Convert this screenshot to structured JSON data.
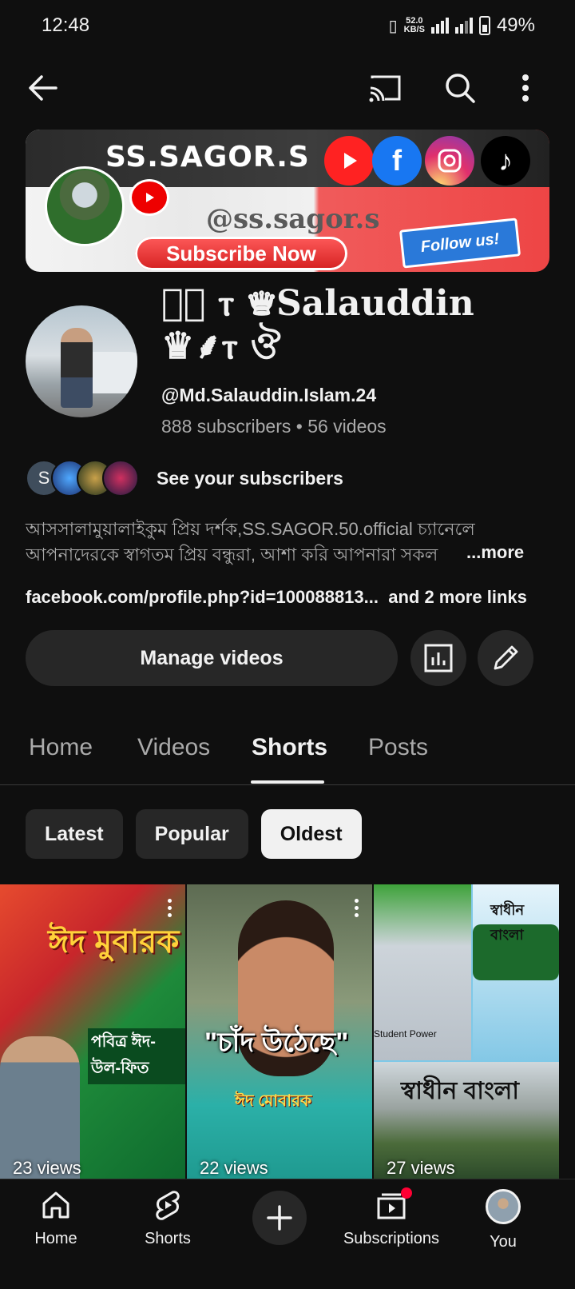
{
  "status": {
    "time": "12:48",
    "net_speed_value": "52.0",
    "net_speed_unit": "KB/S",
    "battery": "49%"
  },
  "banner": {
    "title": "SS.SAGOR.S",
    "handle": "@ss.sagor.s",
    "subscribe": "Subscribe Now",
    "follow": "Follow us!"
  },
  "channel": {
    "name_deco_left": "ঔ৾ ⲧ ♛",
    "name_text": "Salauddin",
    "name_deco_right": "♛⸙ⲧ ঔ",
    "handle": "@Md.Salauddin.Islam.24",
    "stats": "888 subscribers • 56 videos"
  },
  "subscribers_row": {
    "initial": "S",
    "label": "See your subscribers"
  },
  "description": {
    "line1": "আসসালামুয়ালাইকুম প্রিয় দর্শক,SS.SAGOR.50.official  চ্যানেলে",
    "line2": "আপনাদেরকে স্বাগতম প্রিয় বন্ধুরা, আশা করি আপনারা সকল",
    "more": "...more"
  },
  "links": {
    "primary": "facebook.com/profile.php?id=100088813...",
    "extra": "and 2 more links"
  },
  "actions": {
    "manage": "Manage videos"
  },
  "tabs": [
    {
      "label": "Home"
    },
    {
      "label": "Videos"
    },
    {
      "label": "Shorts"
    },
    {
      "label": "Posts"
    }
  ],
  "active_tab": "Shorts",
  "chips": [
    {
      "label": "Latest"
    },
    {
      "label": "Popular"
    },
    {
      "label": "Oldest"
    }
  ],
  "active_chip": "Oldest",
  "shorts": [
    {
      "views": "23 views",
      "text_top": "ঈদ মুবারক",
      "text_mid": "পবিত্র ঈদ-উল-ফিত"
    },
    {
      "views": "22 views",
      "text_top": "\"চাঁদ উঠেছে\"",
      "text_mid": "ঈদ মোবারক"
    },
    {
      "views": "27 views",
      "text_top": "স্বাধীন বাংলা",
      "text_mid": "Student Power",
      "text_bottom": "স্বাধীন বাংলা"
    }
  ],
  "bottom_nav": [
    {
      "label": "Home"
    },
    {
      "label": "Shorts"
    },
    {
      "label": "Subscriptions"
    },
    {
      "label": "You"
    }
  ],
  "colors": {
    "background": "#0f0f0f",
    "surface": "#272727",
    "text_primary": "#f1f1f1",
    "text_secondary": "#aaaaaa",
    "notification_dot": "#ff0033"
  }
}
